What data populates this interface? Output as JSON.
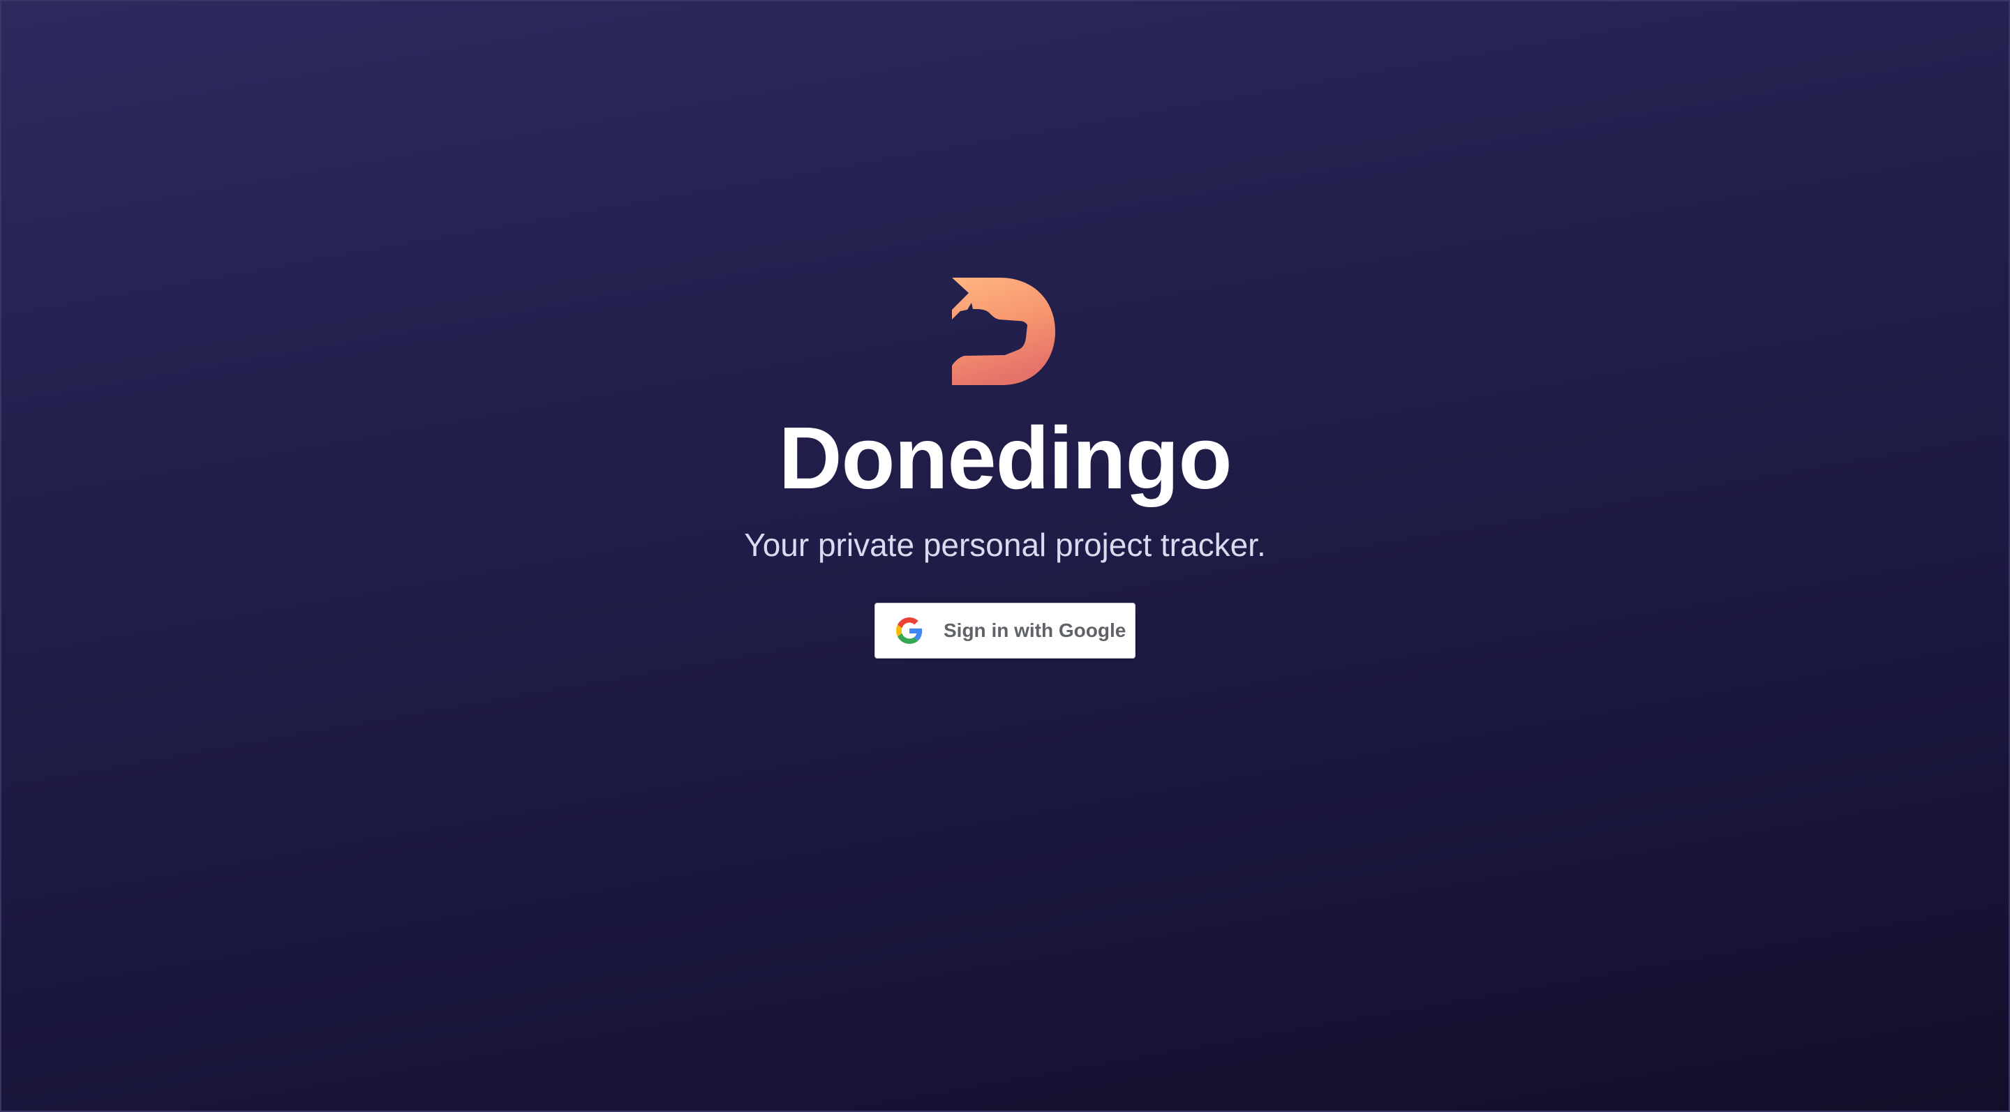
{
  "app": {
    "name": "Donedingo",
    "tagline": "Your private personal project tracker.",
    "logo_icon": "dingo-d-logo-icon"
  },
  "auth": {
    "google_button_label": "Sign in with Google",
    "google_icon": "google-g-icon"
  },
  "colors": {
    "background_top": "#2e2a5e",
    "background_bottom": "#130f2b",
    "logo_gradient_start": "#ffb07e",
    "logo_gradient_end": "#e8776a",
    "title": "#ffffff",
    "subtitle": "#dcdaf0",
    "button_bg": "#ffffff",
    "button_text": "#5f6368"
  }
}
